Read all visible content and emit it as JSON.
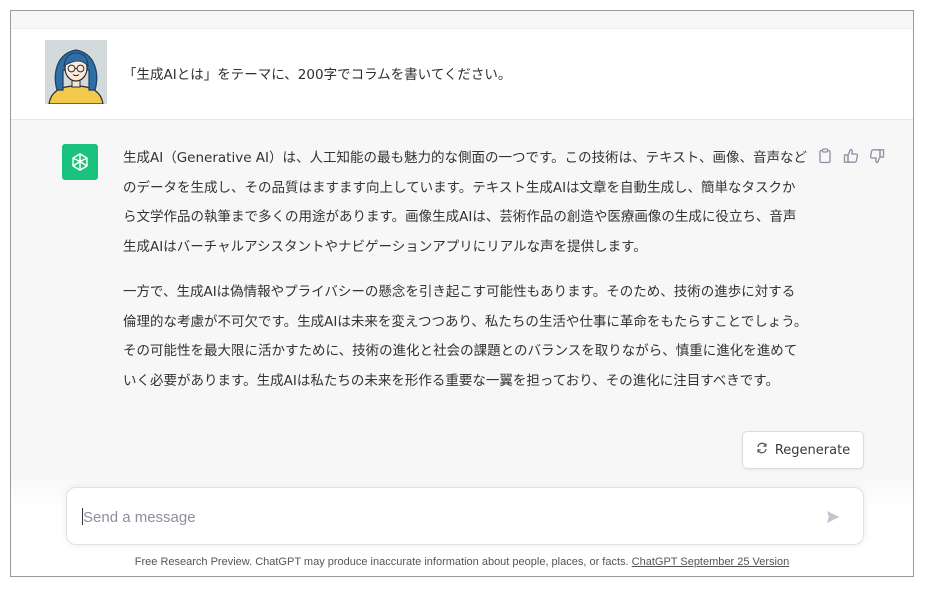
{
  "user_message": {
    "avatar_icon": "woman-avatar-icon",
    "text": "「生成AIとは」をテーマに、200字でコラムを書いてください。"
  },
  "assistant_message": {
    "logo_icon": "chatgpt-logo-icon",
    "paragraphs": [
      "生成AI（Generative AI）は、人工知能の最も魅力的な側面の一つです。この技術は、テキスト、画像、音声などのデータを生成し、その品質はますます向上しています。テキスト生成AIは文章を自動生成し、簡単なタスクから文学作品の執筆まで多くの用途があります。画像生成AIは、芸術作品の創造や医療画像の生成に役立ち、音声生成AIはバーチャルアシスタントやナビゲーションアプリにリアルな声を提供します。",
      "一方で、生成AIは偽情報やプライバシーの懸念を引き起こす可能性もあります。そのため、技術の進歩に対する倫理的な考慮が不可欠です。生成AIは未来を変えつつあり、私たちの生活や仕事に革命をもたらすことでしょう。その可能性を最大限に活かすために、技術の進化と社会の課題とのバランスを取りながら、慎重に進化を進めていく必要があります。生成AIは私たちの未来を形作る重要な一翼を担っており、その進化に注目すべきです。"
    ],
    "actions": [
      "copy-icon",
      "thumbs-up-icon",
      "thumbs-down-icon"
    ]
  },
  "regenerate": {
    "label": "Regenerate",
    "icon": "regenerate-icon"
  },
  "composer": {
    "placeholder": "Send a message",
    "value": "",
    "send_icon": "send-icon"
  },
  "footer": {
    "text": "Free Research Preview. ChatGPT may produce inaccurate information about people, places, or facts. ",
    "link": "ChatGPT September 25 Version"
  },
  "colors": {
    "brand_green": "#19c37d",
    "assistant_bg": "#f7f7f8",
    "placeholder": "#8e8ea0"
  }
}
